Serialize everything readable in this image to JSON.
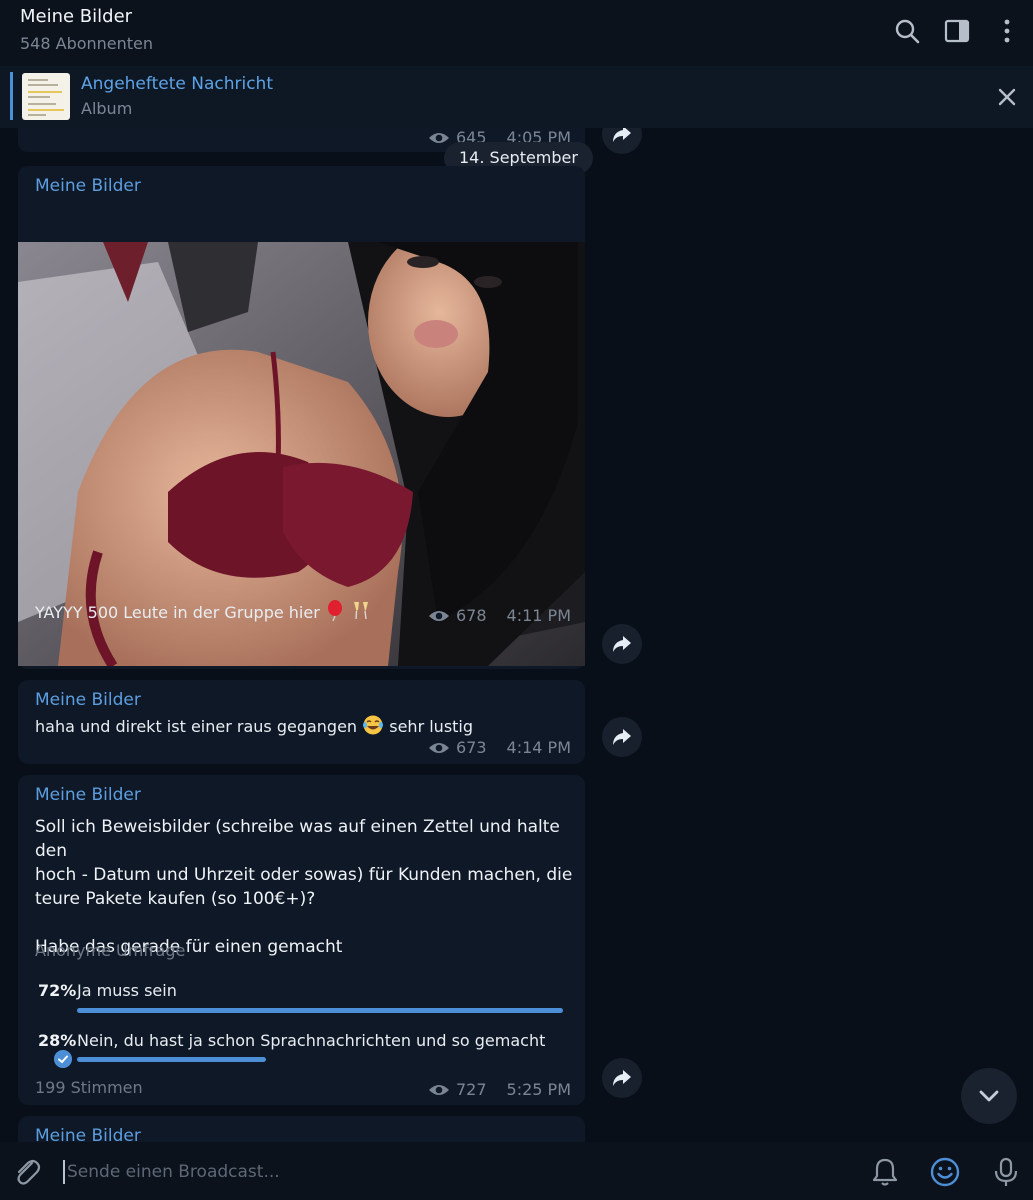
{
  "header": {
    "title": "Meine Bilder",
    "subtitle": "548 Abonnenten"
  },
  "pinned": {
    "title": "Angeheftete Nachricht",
    "subtitle": "Album"
  },
  "date_separator": "14. September",
  "prev_message": {
    "views": "645",
    "time": "4:05 PM"
  },
  "messages": [
    {
      "sender": "Meine Bilder",
      "type": "photo",
      "caption": "YAYYY 500 Leute in der Gruppe hier",
      "caption_emojis": [
        "balloon",
        "champagne-glasses"
      ],
      "views": "678",
      "time": "4:11 PM"
    },
    {
      "sender": "Meine Bilder",
      "type": "text",
      "text_before": "haha und direkt ist einer raus gegangen",
      "text_after": "sehr lustig",
      "emoji": "tears-of-joy",
      "views": "673",
      "time": "4:14 PM"
    },
    {
      "sender": "Meine Bilder",
      "type": "poll",
      "question_lines": [
        "Soll ich Beweisbilder (schreibe was auf einen Zettel und halte den",
        "hoch - Datum und Uhrzeit oder sowas) für Kunden machen, die",
        "teure Pakete kaufen (so 100€+)?",
        "",
        "Habe das gerade für einen gemacht"
      ],
      "poll_type": "Anonyme Umfrage",
      "options": [
        {
          "percent": "72%",
          "label": "Ja muss sein",
          "fraction": 0.72,
          "chosen": false
        },
        {
          "percent": "28%",
          "label": "Nein, du hast ja schon Sprachnachrichten und so gemacht",
          "fraction": 0.28,
          "chosen": true
        }
      ],
      "votes": "199 Stimmen",
      "views": "727",
      "time": "5:25 PM"
    },
    {
      "sender": "Meine Bilder",
      "type": "partial"
    }
  ],
  "input": {
    "placeholder": "Sende einen Broadcast..."
  },
  "icons": {
    "header": [
      "search-icon",
      "sidebar-icon",
      "more-vertical-icon"
    ],
    "input": [
      "attach-icon",
      "bell-icon",
      "emoji-icon",
      "microphone-icon"
    ]
  },
  "colors": {
    "background": "#090f19",
    "bubble": "#0f1826",
    "accent": "#5d9ee0",
    "poll_bar": "#4d8fd6"
  }
}
